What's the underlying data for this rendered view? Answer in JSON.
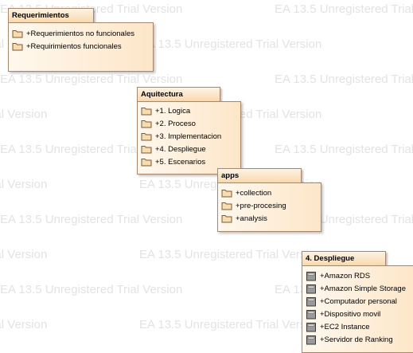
{
  "watermark": {
    "text": "EA 13.5 Unregistered Trial Version"
  },
  "packages": [
    {
      "title": "Requerimientos",
      "items": [
        {
          "label": "+Requerimientos no funcionales",
          "icon": "folder-icon"
        },
        {
          "label": "+Requirimientos funcionales",
          "icon": "folder-icon"
        }
      ]
    },
    {
      "title": "Aquitectura",
      "items": [
        {
          "label": "+1. Logica",
          "icon": "folder-icon"
        },
        {
          "label": "+2. Proceso",
          "icon": "folder-icon"
        },
        {
          "label": "+3. Implementacion",
          "icon": "folder-icon"
        },
        {
          "label": "+4. Despliegue",
          "icon": "folder-icon"
        },
        {
          "label": "+5. Escenarios",
          "icon": "folder-icon"
        }
      ]
    },
    {
      "title": "apps",
      "items": [
        {
          "label": "+collection",
          "icon": "folder-icon"
        },
        {
          "label": "+pre-procesing",
          "icon": "folder-icon"
        },
        {
          "label": "+analysis",
          "icon": "folder-icon"
        }
      ]
    },
    {
      "title": "4. Despliegue",
      "items": [
        {
          "label": "+Amazon RDS",
          "icon": "node-icon"
        },
        {
          "label": "+Amazon Simple Storage",
          "icon": "node-icon"
        },
        {
          "label": "+Computador personal",
          "icon": "node-icon"
        },
        {
          "label": "+Dispositivo movil",
          "icon": "node-icon"
        },
        {
          "label": "+EC2 Instance",
          "icon": "node-icon"
        },
        {
          "label": "+Servidor de Ranking",
          "icon": "node-icon"
        }
      ]
    }
  ],
  "colors": {
    "package_fill": "#fde6c8",
    "package_border": "#a8876a",
    "watermark": "#e3e3e3"
  }
}
